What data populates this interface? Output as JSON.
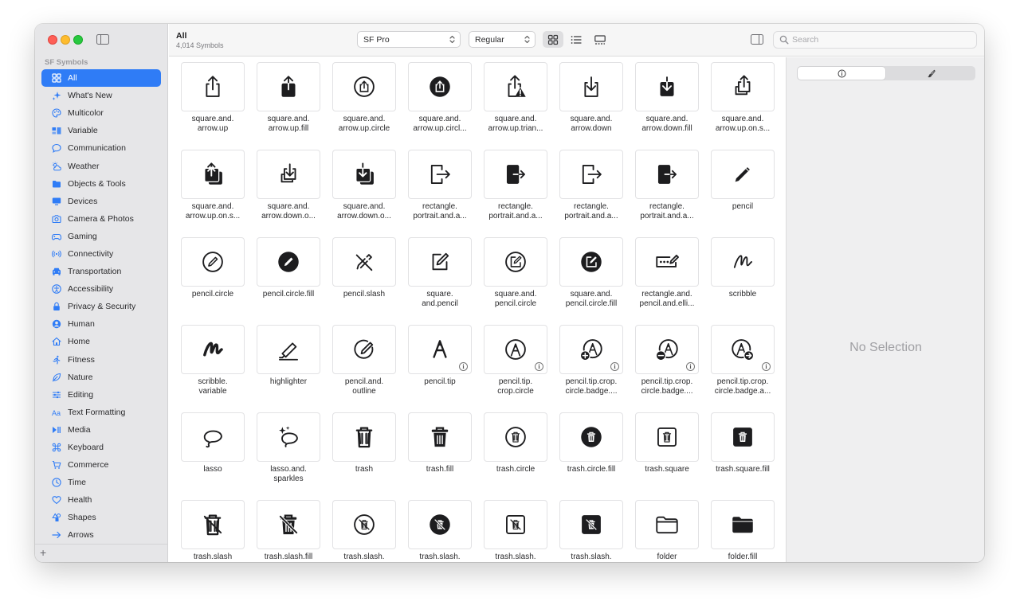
{
  "sidebar": {
    "heading": "SF Symbols",
    "items": [
      {
        "label": "All",
        "icon": "grid-icon",
        "active": true
      },
      {
        "label": "What's New",
        "icon": "sparkles-icon"
      },
      {
        "label": "Multicolor",
        "icon": "palette-icon"
      },
      {
        "label": "Variable",
        "icon": "variable-icon"
      },
      {
        "label": "Communication",
        "icon": "bubble-icon"
      },
      {
        "label": "Weather",
        "icon": "cloud-sun-icon"
      },
      {
        "label": "Objects & Tools",
        "icon": "folder-icon"
      },
      {
        "label": "Devices",
        "icon": "display-icon"
      },
      {
        "label": "Camera & Photos",
        "icon": "camera-icon"
      },
      {
        "label": "Gaming",
        "icon": "gamecontroller-icon"
      },
      {
        "label": "Connectivity",
        "icon": "antenna-icon"
      },
      {
        "label": "Transportation",
        "icon": "car-icon"
      },
      {
        "label": "Accessibility",
        "icon": "accessibility-icon"
      },
      {
        "label": "Privacy & Security",
        "icon": "lock-icon"
      },
      {
        "label": "Human",
        "icon": "person-circle-icon"
      },
      {
        "label": "Home",
        "icon": "house-icon"
      },
      {
        "label": "Fitness",
        "icon": "figure-run-icon"
      },
      {
        "label": "Nature",
        "icon": "leaf-icon"
      },
      {
        "label": "Editing",
        "icon": "sliders-icon"
      },
      {
        "label": "Text Formatting",
        "icon": "textformat-icon"
      },
      {
        "label": "Media",
        "icon": "playpause-icon"
      },
      {
        "label": "Keyboard",
        "icon": "command-icon"
      },
      {
        "label": "Commerce",
        "icon": "cart-icon"
      },
      {
        "label": "Time",
        "icon": "clock-icon"
      },
      {
        "label": "Health",
        "icon": "heart-icon"
      },
      {
        "label": "Shapes",
        "icon": "shapes-icon"
      },
      {
        "label": "Arrows",
        "icon": "arrow-right-icon"
      }
    ],
    "add_label": "+"
  },
  "toolbar": {
    "title": "All",
    "subtitle": "4,014 Symbols",
    "font_select": "SF Pro",
    "weight_select": "Regular",
    "search_placeholder": "Search"
  },
  "symbols": [
    {
      "label": "square.and.\narrow.up",
      "icon": "share",
      "info": false
    },
    {
      "label": "square.and.\narrow.up.fill",
      "icon": "share-fill",
      "info": false
    },
    {
      "label": "square.and.\narrow.up.circle",
      "icon": "share-circle",
      "info": false
    },
    {
      "label": "square.and.\narrow.up.circl...",
      "icon": "share-circle-fill",
      "info": false
    },
    {
      "label": "square.and.\narrow.up.trian...",
      "icon": "share-triangle",
      "info": false
    },
    {
      "label": "square.and.\narrow.down",
      "icon": "download",
      "info": false
    },
    {
      "label": "square.and.\narrow.down.fill",
      "icon": "download-fill",
      "info": false
    },
    {
      "label": "square.and.\narrow.up.on.s...",
      "icon": "share-stack",
      "info": false
    },
    {
      "label": "square.and.\narrow.up.on.s...",
      "icon": "share-stack-fill",
      "info": false
    },
    {
      "label": "square.and.\narrow.down.o...",
      "icon": "download-stack",
      "info": false
    },
    {
      "label": "square.and.\narrow.down.o...",
      "icon": "download-stack-fill",
      "info": false
    },
    {
      "label": "rectangle.\nportrait.and.a...",
      "icon": "door-exit",
      "info": false
    },
    {
      "label": "rectangle.\nportrait.and.a...",
      "icon": "door-exit-fill",
      "info": false
    },
    {
      "label": "rectangle.\nportrait.and.a...",
      "icon": "door-exit",
      "info": false
    },
    {
      "label": "rectangle.\nportrait.and.a...",
      "icon": "door-exit-fill",
      "info": false
    },
    {
      "label": "pencil",
      "icon": "pencil",
      "info": false
    },
    {
      "label": "pencil.circle",
      "icon": "pencil-circle",
      "info": false
    },
    {
      "label": "pencil.circle.fill",
      "icon": "pencil-circle-fill",
      "info": false
    },
    {
      "label": "pencil.slash",
      "icon": "pencil-slash",
      "info": false
    },
    {
      "label": "square.\nand.pencil",
      "icon": "square-pencil",
      "info": false
    },
    {
      "label": "square.and.\npencil.circle",
      "icon": "square-pencil-circle",
      "info": false
    },
    {
      "label": "square.and.\npencil.circle.fill",
      "icon": "square-pencil-circle-fill",
      "info": false
    },
    {
      "label": "rectangle.and.\npencil.and.elli...",
      "icon": "rect-pencil-dots",
      "info": false
    },
    {
      "label": "scribble",
      "icon": "scribble",
      "info": false
    },
    {
      "label": "scribble.\nvariable",
      "icon": "scribble-bold",
      "info": false
    },
    {
      "label": "highlighter",
      "icon": "highlighter",
      "info": false
    },
    {
      "label": "pencil.and.\noutline",
      "icon": "pencil-outline",
      "info": false
    },
    {
      "label": "pencil.tip",
      "icon": "pencil-tip",
      "info": true
    },
    {
      "label": "pencil.tip.\ncrop.circle",
      "icon": "pencil-tip-circle",
      "info": true
    },
    {
      "label": "pencil.tip.crop.\ncircle.badge....",
      "icon": "pencil-tip-plus",
      "info": true
    },
    {
      "label": "pencil.tip.crop.\ncircle.badge....",
      "icon": "pencil-tip-minus",
      "info": true
    },
    {
      "label": "pencil.tip.crop.\ncircle.badge.a...",
      "icon": "pencil-tip-arrow",
      "info": true
    },
    {
      "label": "lasso",
      "icon": "lasso",
      "info": false
    },
    {
      "label": "lasso.and.\nsparkles",
      "icon": "lasso-sparkles",
      "info": false
    },
    {
      "label": "trash",
      "icon": "trash",
      "info": false
    },
    {
      "label": "trash.fill",
      "icon": "trash-fill",
      "info": false
    },
    {
      "label": "trash.circle",
      "icon": "trash-circle",
      "info": false
    },
    {
      "label": "trash.circle.fill",
      "icon": "trash-circle-fill",
      "info": false
    },
    {
      "label": "trash.square",
      "icon": "trash-square",
      "info": false
    },
    {
      "label": "trash.square.fill",
      "icon": "trash-square-fill",
      "info": false
    },
    {
      "label": "trash.slash",
      "icon": "trash-slash",
      "info": false
    },
    {
      "label": "trash.slash.fill",
      "icon": "trash-slash-fill",
      "info": false
    },
    {
      "label": "trash.slash.",
      "icon": "trash-slash-circle",
      "info": false
    },
    {
      "label": "trash.slash.",
      "icon": "trash-slash-circle-fill",
      "info": false
    },
    {
      "label": "trash.slash.",
      "icon": "trash-slash-square",
      "info": false
    },
    {
      "label": "trash.slash.",
      "icon": "trash-slash-square-fill",
      "info": false
    },
    {
      "label": "folder",
      "icon": "folder",
      "info": false
    },
    {
      "label": "folder.fill",
      "icon": "folder-fill",
      "info": false
    }
  ],
  "inspector": {
    "empty_text": "No Selection"
  },
  "colors": {
    "accent": "#2f7cf6",
    "symbol": "#1d1d1f"
  }
}
